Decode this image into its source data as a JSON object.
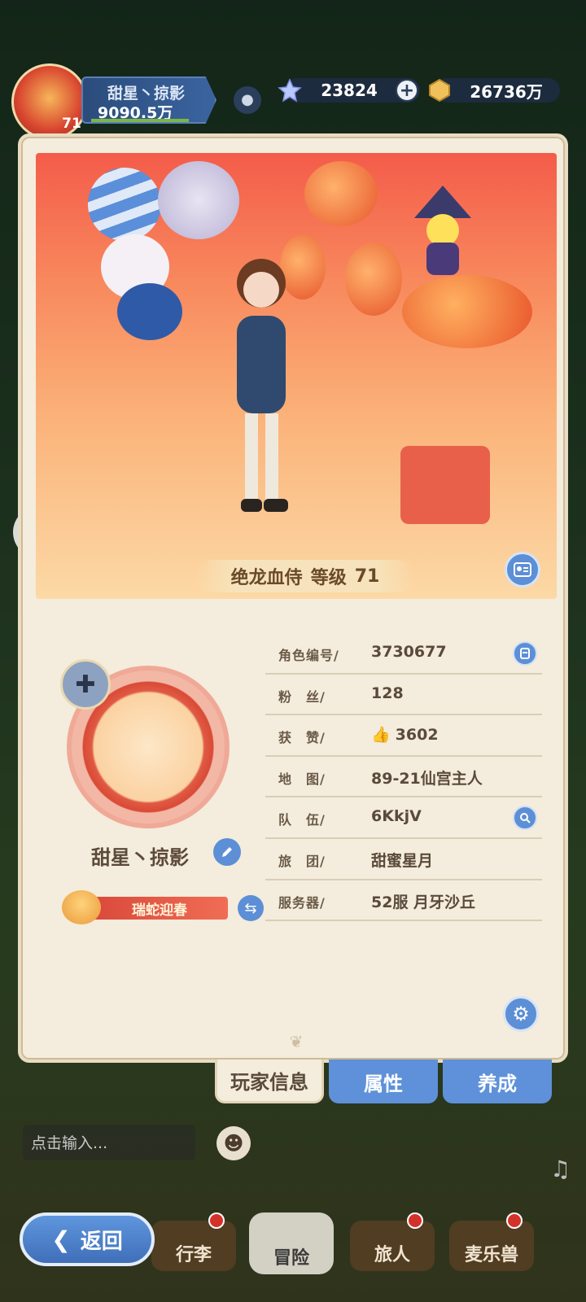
{
  "topbar": {
    "player_name": "甜星丶掠影",
    "power": "9090.5万",
    "level": "71",
    "star_currency": "23824",
    "gold_currency": "26736万"
  },
  "character": {
    "title": "绝龙血侍",
    "level_label": "等级",
    "level": "71"
  },
  "profile": {
    "player_name": "甜星丶掠影",
    "title_badge": "瑞蛇迎春",
    "rows": [
      {
        "label": "角色编号/",
        "value": "3730677"
      },
      {
        "label": "粉　丝/",
        "value": "128"
      },
      {
        "label": "获　赞/",
        "value": "3602"
      },
      {
        "label": "地　图/",
        "value": "89-21仙宫主人"
      },
      {
        "label": "队　伍/",
        "value": "6KkjV"
      },
      {
        "label": "旅　团/",
        "value": "甜蜜星月"
      },
      {
        "label": "服务器/",
        "value": "52服  月牙沙丘"
      }
    ]
  },
  "tabs": [
    {
      "label": "玩家信息",
      "active": true
    },
    {
      "label": "属性"
    },
    {
      "label": "养成"
    }
  ],
  "chat": {
    "placeholder": "点击输入..."
  },
  "bottom_nav": {
    "back": "返回",
    "items": [
      "行李",
      "冒险",
      "旅人",
      "麦乐兽"
    ]
  },
  "colors": {
    "accent": "#5c8fd6",
    "card_bg": "#f4ecdc",
    "ribbon": "#d9493a"
  }
}
